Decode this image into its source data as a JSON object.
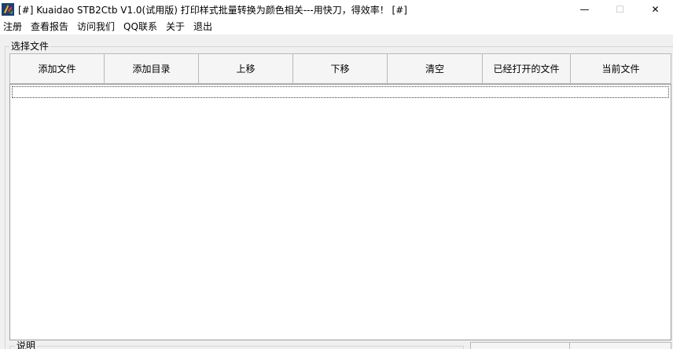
{
  "window": {
    "title": "[#] Kuaidao STB2Ctb  V1.0(试用版) 打印样式批量转换为颜色相关---用快刀，得效率！ [#]",
    "minimize_glyph": "—",
    "maximize_glyph": "☐",
    "close_glyph": "✕"
  },
  "menu": {
    "items": [
      "注册",
      "查看报告",
      "访问我们",
      "QQ联系",
      "关于",
      "退出"
    ]
  },
  "file_group": {
    "title": "选择文件",
    "buttons": [
      "添加文件",
      "添加目录",
      "上移",
      "下移",
      "清空",
      "已经打开的文件",
      "当前文件"
    ]
  },
  "description_group": {
    "title": "说明"
  }
}
